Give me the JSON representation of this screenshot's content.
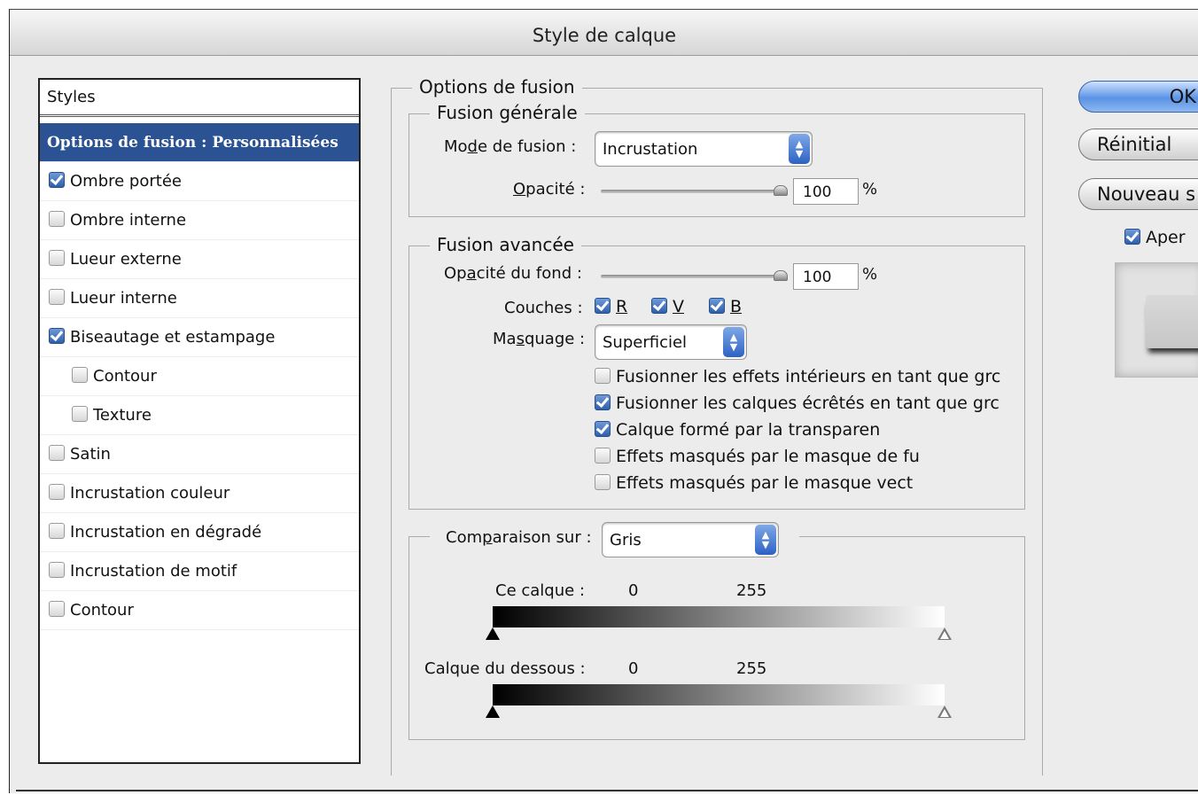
{
  "window": {
    "title": "Style de calque"
  },
  "styles_panel": {
    "header": "Styles",
    "items": [
      {
        "label": "Options de fusion : Personnalisées",
        "selected": true
      },
      {
        "label": "Ombre portée",
        "checked": true
      },
      {
        "label": "Ombre interne",
        "checked": false
      },
      {
        "label": "Lueur externe",
        "checked": false
      },
      {
        "label": "Lueur interne",
        "checked": false
      },
      {
        "label": "Biseautage et estampage",
        "checked": true
      },
      {
        "label": "Contour",
        "checked": false,
        "indent": true
      },
      {
        "label": "Texture",
        "checked": false,
        "indent": true
      },
      {
        "label": "Satin",
        "checked": false
      },
      {
        "label": "Incrustation couleur",
        "checked": false
      },
      {
        "label": "Incrustation en dégradé",
        "checked": false
      },
      {
        "label": "Incrustation de motif",
        "checked": false
      },
      {
        "label": "Contour",
        "checked": false
      }
    ]
  },
  "blending": {
    "title": "Options de fusion",
    "general": {
      "title": "Fusion générale",
      "mode_label": "Mode de fusion :",
      "mode_value": "Incrustation",
      "opacity_label": "Opacité :",
      "opacity_value": "100",
      "opacity_unit": "%",
      "opacity_level": 1.0
    },
    "advanced": {
      "title": "Fusion avancée",
      "fill_label": "Opacité du fond :",
      "fill_value": "100",
      "fill_unit": "%",
      "fill_level": 1.0,
      "channels_label": "Couches :",
      "channels": [
        {
          "label": "R",
          "checked": true
        },
        {
          "label": "V",
          "checked": true
        },
        {
          "label": "B",
          "checked": true
        }
      ],
      "knockout_label": "Masquage :",
      "knockout_value": "Superficiel",
      "options": [
        {
          "label": "Fusionner les effets intérieurs en tant que grc",
          "checked": false
        },
        {
          "label": "Fusionner les calques écrêtés en tant que grc",
          "checked": true
        },
        {
          "label": "Calque formé par la transparen",
          "checked": true
        },
        {
          "label": "Effets masqués par le masque de fu",
          "checked": false
        },
        {
          "label": "Effets masqués par le masque vect",
          "checked": false
        }
      ]
    },
    "blend_if": {
      "label": "Comparaison sur :",
      "value": "Gris",
      "this_layer_label": "Ce calque :",
      "this_layer_min": "0",
      "this_layer_max": "255",
      "under_layer_label": "Calque du dessous :",
      "under_layer_min": "0",
      "under_layer_max": "255"
    }
  },
  "buttons": {
    "ok": "OK",
    "reset": "Réinitial",
    "new_style": "Nouveau s",
    "preview_label": "Aper",
    "preview_checked": true
  }
}
